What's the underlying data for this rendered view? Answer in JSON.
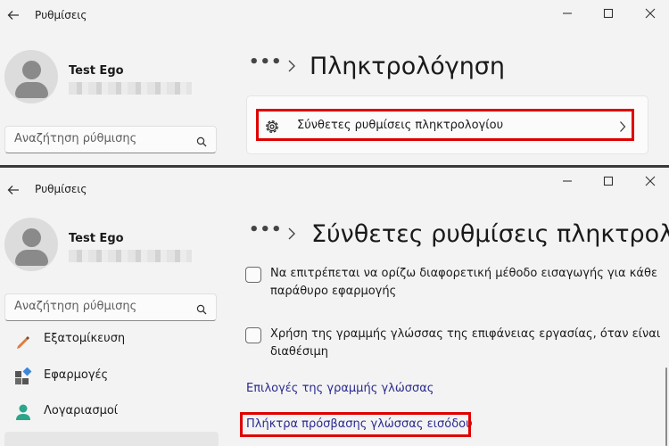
{
  "top": {
    "app_title": "Ρυθμίσεις",
    "user_name": "Test Ego",
    "search_placeholder": "Αναζήτηση ρύθμισης",
    "page_title": "Πληκτρολόγηση",
    "card_label": "Σύνθετες ρυθμίσεις πληκτρολογίου"
  },
  "bottom": {
    "app_title": "Ρυθμίσεις",
    "user_name": "Test Ego",
    "search_placeholder": "Αναζήτηση ρύθμισης",
    "page_title": "Σύνθετες ρυθμίσεις πληκτρολ",
    "nav": [
      {
        "label": "Εξατομίκευση",
        "icon": "brush-icon"
      },
      {
        "label": "Εφαρμογές",
        "icon": "apps-icon"
      },
      {
        "label": "Λογαριασμοί",
        "icon": "account-icon"
      }
    ],
    "checkboxes": [
      {
        "text": "Να επιτρέπεται να ορίζω διαφορετική μέθοδο εισαγωγής για κάθε παράθυρο εφαρμογής",
        "checked": false
      },
      {
        "text": "Χρήση της γραμμής γλώσσας της επιφάνειας εργασίας, όταν είναι διαθέσιμη",
        "checked": false
      }
    ],
    "link1": "Επιλογές της γραμμής γλώσσας",
    "link2": "Πλήκτρα πρόσβασης γλώσσας εισόδου"
  },
  "colors": {
    "highlight": "#e00000",
    "link": "#2a2a8f",
    "background": "#f3f3f3"
  }
}
